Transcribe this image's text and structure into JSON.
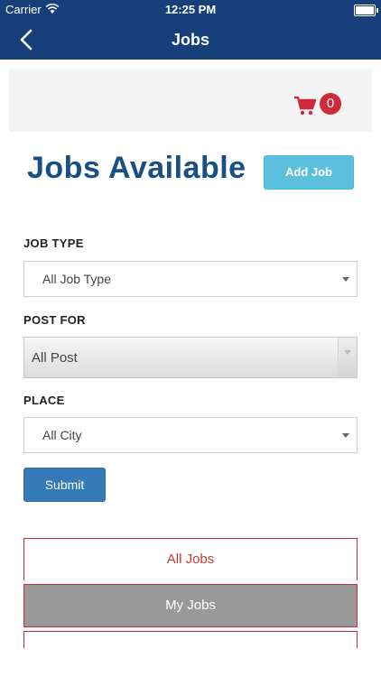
{
  "status_bar": {
    "carrier": "Carrier",
    "time": "12:25 PM",
    "wifi_icon": "wifi-icon",
    "battery_icon": "battery-icon"
  },
  "nav": {
    "title": "Jobs",
    "back_icon": "chevron-left-icon"
  },
  "cart": {
    "icon": "shopping-cart-icon",
    "count": "0",
    "badge_color": "#d0293a",
    "icon_color": "#d0293a"
  },
  "header": {
    "title": "Jobs Available",
    "add_button": "Add Job"
  },
  "form": {
    "job_type": {
      "label": "JOB TYPE",
      "value": "All Job Type"
    },
    "post_for": {
      "label": "POST FOR",
      "value": "All Post"
    },
    "place": {
      "label": "PLACE",
      "value": "All City"
    },
    "submit_label": "Submit"
  },
  "tabs": [
    {
      "label": "All Jobs",
      "active": false
    },
    {
      "label": "My Jobs",
      "active": true
    },
    {
      "label": "",
      "active": false
    }
  ],
  "colors": {
    "nav_bg": "#173f7a",
    "title_color": "#174f86",
    "add_button_bg": "#5bc0de",
    "submit_bg": "#337ab7",
    "tab_border": "#d0293a",
    "active_tab_bg": "#999999"
  }
}
